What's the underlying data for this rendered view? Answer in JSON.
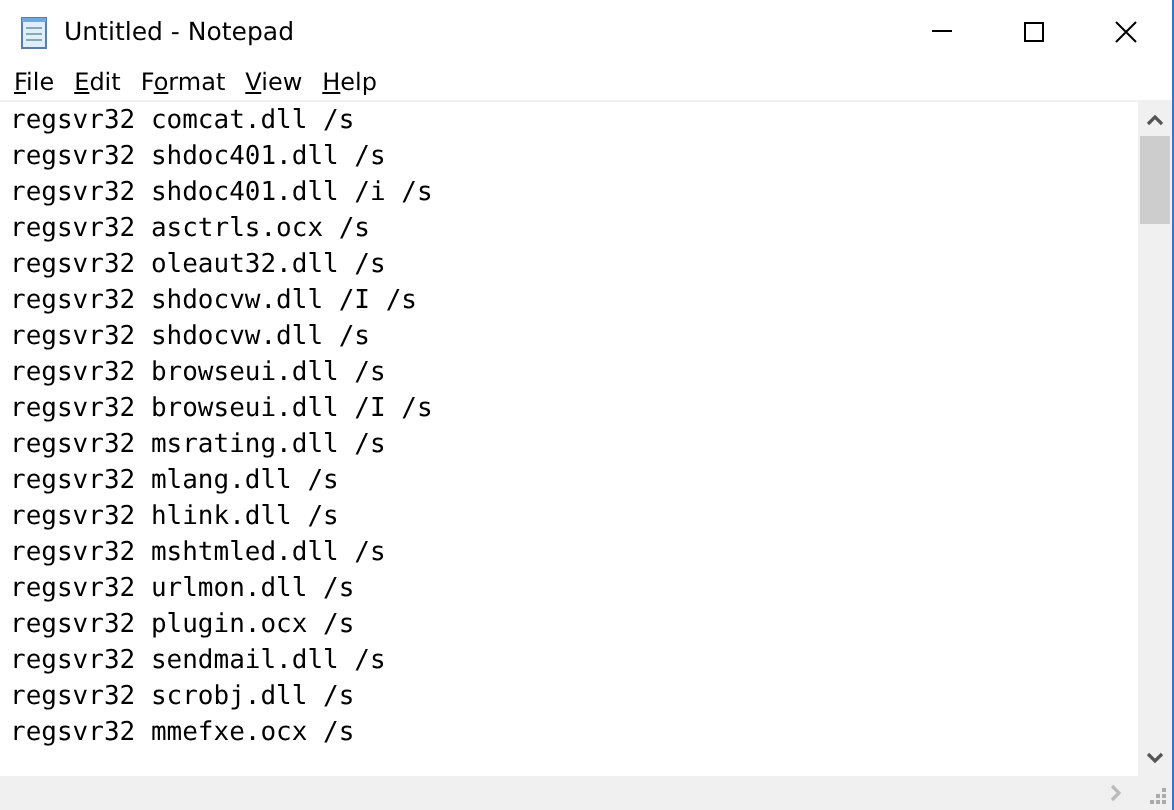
{
  "window": {
    "title": "Untitled - Notepad"
  },
  "menu": [
    {
      "access_key": "F",
      "rest": "ile"
    },
    {
      "access_key": "E",
      "rest": "dit"
    },
    {
      "before": "F",
      "access_key": "o",
      "rest": "rmat"
    },
    {
      "access_key": "V",
      "rest": "iew"
    },
    {
      "access_key": "H",
      "rest": "elp"
    }
  ],
  "editor": {
    "lines": [
      "regsvr32 comcat.dll /s",
      "regsvr32 shdoc401.dll /s",
      "regsvr32 shdoc401.dll /i /s",
      "regsvr32 asctrls.ocx /s",
      "regsvr32 oleaut32.dll /s",
      "regsvr32 shdocvw.dll /I /s",
      "regsvr32 shdocvw.dll /s",
      "regsvr32 browseui.dll /s",
      "regsvr32 browseui.dll /I /s",
      "regsvr32 msrating.dll /s",
      "regsvr32 mlang.dll /s",
      "regsvr32 hlink.dll /s",
      "regsvr32 mshtmled.dll /s",
      "regsvr32 urlmon.dll /s",
      "regsvr32 plugin.ocx /s",
      "regsvr32 sendmail.dll /s",
      "regsvr32 scrobj.dll /s",
      "regsvr32 mmefxe.ocx /s"
    ]
  }
}
